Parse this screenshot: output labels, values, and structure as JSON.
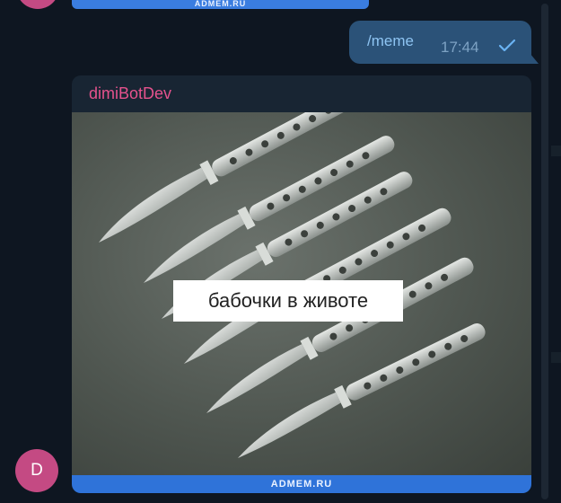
{
  "previous_message": {
    "watermark": "ADMEM.RU"
  },
  "outgoing_message": {
    "text": "/meme",
    "time": "17:44",
    "status_icon": "single-check-icon"
  },
  "incoming_message": {
    "sender": "dimiBotDev",
    "photo": {
      "caption": "бабочки в животе",
      "watermark": "ADMEM.RU"
    },
    "avatar_initial": "D"
  },
  "colors": {
    "background": "#0e1621",
    "outgoing_bubble": "#2b5278",
    "incoming_bubble": "#182533",
    "sender_name": "#e5528d",
    "avatar": "#c44a83",
    "watermark_strip": "#2f73d9"
  }
}
